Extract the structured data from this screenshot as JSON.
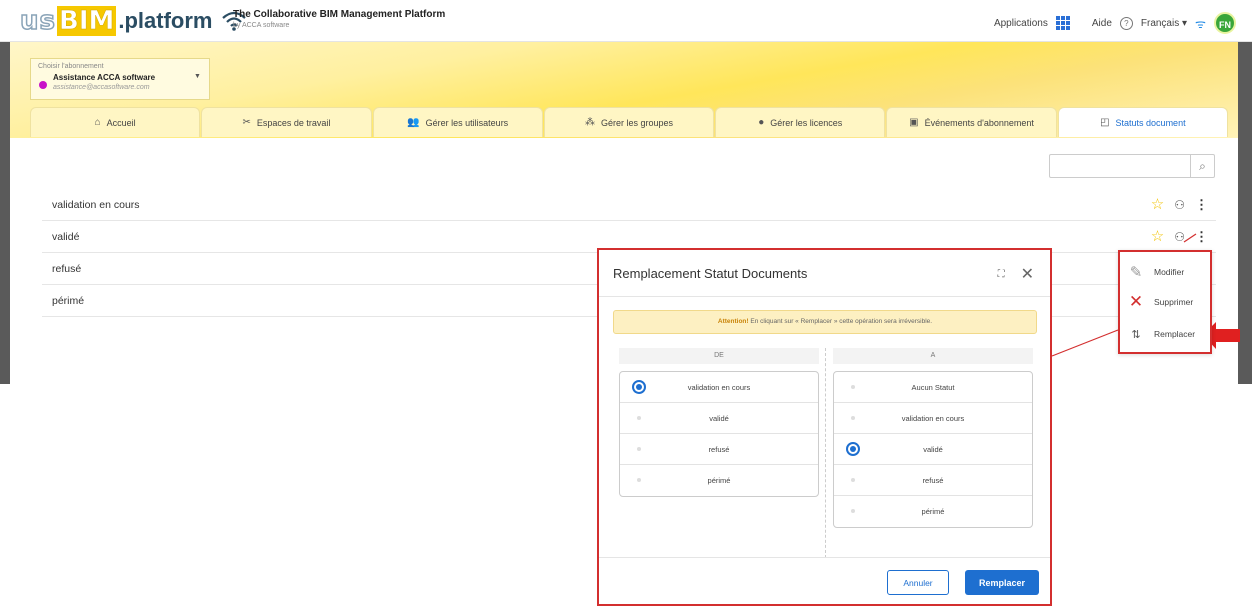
{
  "brand": {
    "logo_us": "us",
    "logo_bim": "BIM",
    "logo_platform": ".platform",
    "tagline": "The Collaborative BIM Management Platform",
    "byline": "by ACCA software"
  },
  "topright": {
    "applications": "Applications",
    "help": "Aide",
    "language": "Français ▾",
    "avatar": "FN"
  },
  "subscription": {
    "label": "Choisir l'abonnement",
    "name": "Assistance ACCA software",
    "email": "assistance@accasoftware.com"
  },
  "tabs": [
    {
      "label": "Accueil",
      "icon": "home-icon"
    },
    {
      "label": "Espaces de travail",
      "icon": "tools-icon"
    },
    {
      "label": "Gérer les utilisateurs",
      "icon": "add-user-icon"
    },
    {
      "label": "Gérer les groupes",
      "icon": "group-icon"
    },
    {
      "label": "Gérer les licences",
      "icon": "license-icon"
    },
    {
      "label": "Événements d'abonnement",
      "icon": "events-icon"
    },
    {
      "label": "Statuts document",
      "icon": "document-status-icon",
      "active": true
    }
  ],
  "search": {
    "placeholder": ""
  },
  "statuses": [
    "validation en cours",
    "validé",
    "refusé",
    "périmé"
  ],
  "context_menu": {
    "edit": "Modifier",
    "delete": "Supprimer",
    "replace": "Remplacer"
  },
  "modal": {
    "title": "Remplacement Statut Documents",
    "warning_bold": "Attention!",
    "warning_text": " En cliquant sur « Remplacer » cette opération sera irréversible.",
    "from_header": "DE",
    "to_header": "A",
    "from_options": [
      {
        "label": "validation en cours",
        "selected": true
      },
      {
        "label": "validé",
        "selected": false
      },
      {
        "label": "refusé",
        "selected": false
      },
      {
        "label": "périmé",
        "selected": false
      }
    ],
    "to_options": [
      {
        "label": "Aucun Statut",
        "selected": false
      },
      {
        "label": "validation en cours",
        "selected": false
      },
      {
        "label": "validé",
        "selected": true
      },
      {
        "label": "refusé",
        "selected": false
      },
      {
        "label": "périmé",
        "selected": false
      }
    ],
    "cancel": "Annuler",
    "confirm": "Remplacer"
  },
  "colors": {
    "accent": "#1e6fd0",
    "highlight": "#d32f2f",
    "star": "#f2c200"
  }
}
